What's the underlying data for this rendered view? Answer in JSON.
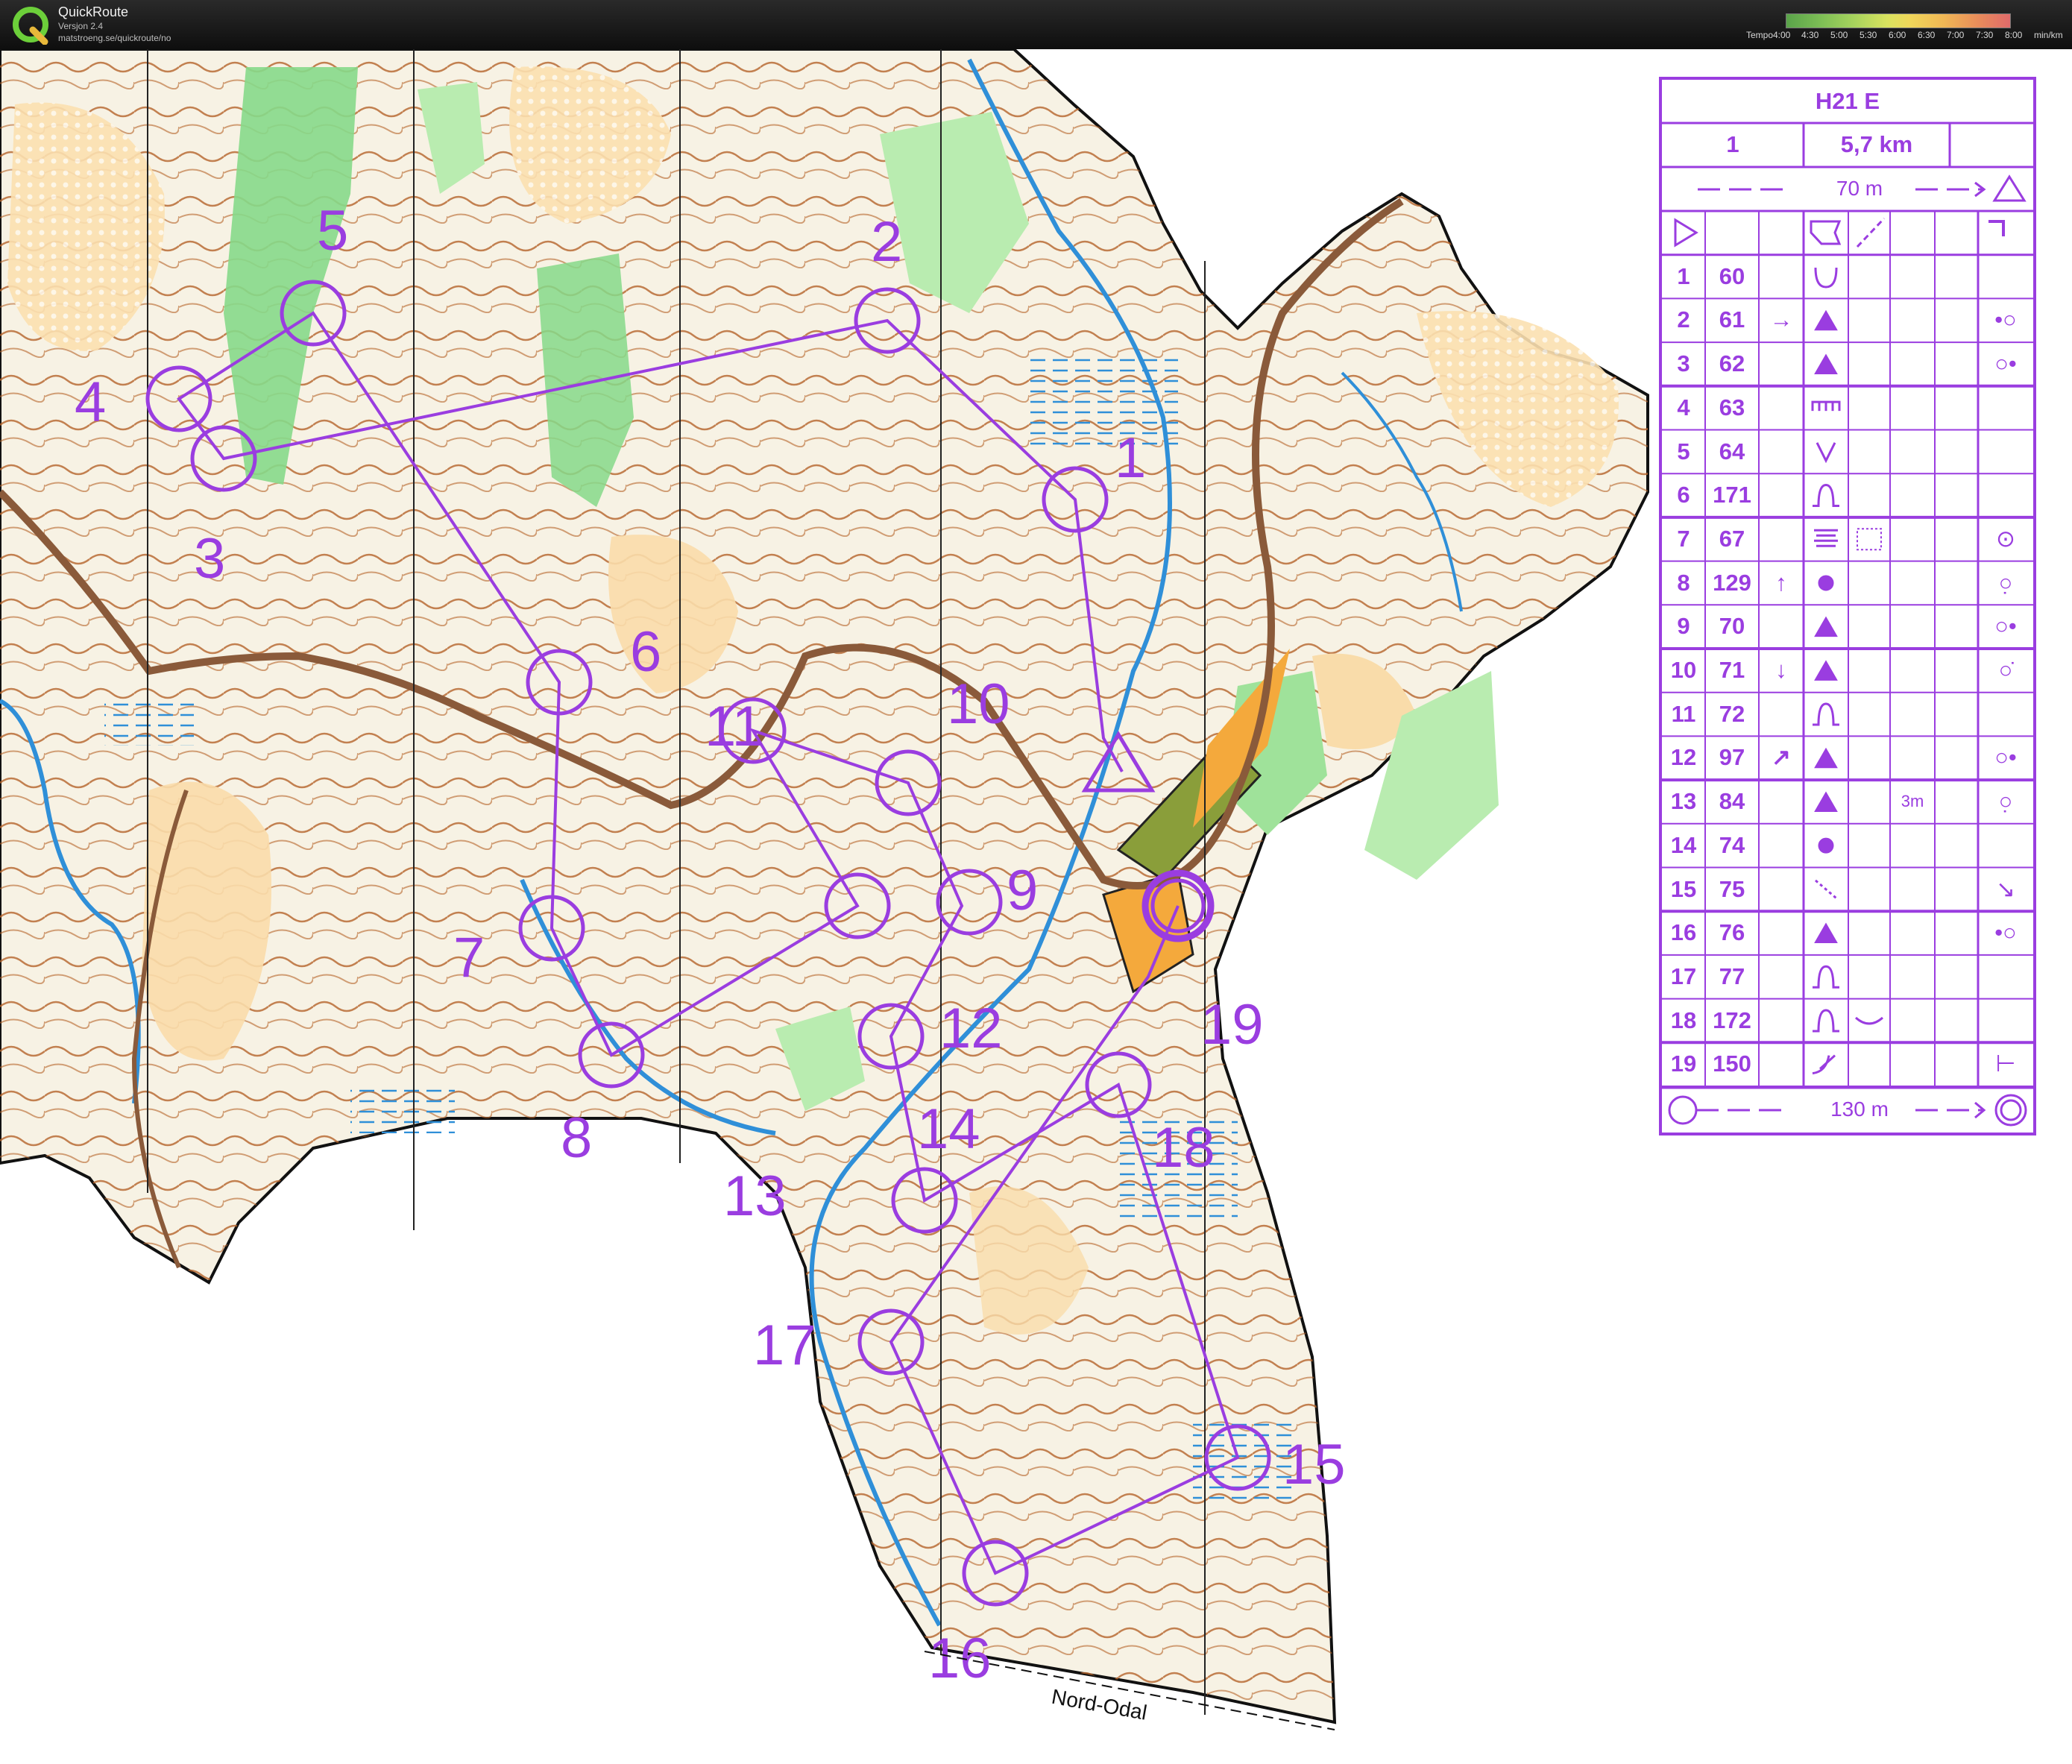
{
  "titlebar": {
    "app_name": "QuickRoute",
    "app_version": "Versjon 2.4",
    "app_url": "matstroeng.se/quickroute/no",
    "tempo_label": "Tempo",
    "tempo_ticks": [
      "4:00",
      "4:30",
      "5:00",
      "5:30",
      "6:00",
      "6:30",
      "7:00",
      "7:30",
      "8:00",
      "min/km"
    ]
  },
  "map": {
    "place_label": "Nord-Odal",
    "course_color": "#9a3de0",
    "controls": [
      {
        "n": "1"
      },
      {
        "n": "2"
      },
      {
        "n": "3"
      },
      {
        "n": "4"
      },
      {
        "n": "5"
      },
      {
        "n": "6"
      },
      {
        "n": "7"
      },
      {
        "n": "8"
      },
      {
        "n": "9"
      },
      {
        "n": "10"
      },
      {
        "n": "11"
      },
      {
        "n": "12"
      },
      {
        "n": "13"
      },
      {
        "n": "14"
      },
      {
        "n": "15"
      },
      {
        "n": "16"
      },
      {
        "n": "17"
      },
      {
        "n": "18"
      },
      {
        "n": "19"
      }
    ]
  },
  "description": {
    "class_name": "H21 E",
    "course_number": "1",
    "course_length": "5,7 km",
    "start_to_first": "70 m",
    "finish_distance": "130 m",
    "rows": [
      {
        "seq": "1",
        "code": "60",
        "dir": "",
        "feature": "reentrant",
        "extra": "",
        "pos": ""
      },
      {
        "seq": "2",
        "code": "61",
        "dir": "→",
        "feature": "boulder",
        "extra": "",
        "pos": "•○"
      },
      {
        "seq": "3",
        "code": "62",
        "dir": "",
        "feature": "boulder",
        "extra": "",
        "pos": "○•"
      },
      {
        "seq": "4",
        "code": "63",
        "dir": "",
        "feature": "cliff",
        "extra": "",
        "pos": ""
      },
      {
        "seq": "5",
        "code": "64",
        "dir": "",
        "feature": "gully",
        "extra": "",
        "pos": ""
      },
      {
        "seq": "6",
        "code": "171",
        "dir": "",
        "feature": "knoll",
        "extra": "",
        "pos": ""
      },
      {
        "seq": "7",
        "code": "67",
        "dir": "",
        "feature": "marsh",
        "extra": "thicket",
        "pos": "⊙"
      },
      {
        "seq": "8",
        "code": "129",
        "dir": "↑",
        "feature": "knoll-dot",
        "extra": "",
        "pos": "○̣"
      },
      {
        "seq": "9",
        "code": "70",
        "dir": "",
        "feature": "boulder",
        "extra": "",
        "pos": "○•"
      },
      {
        "seq": "10",
        "code": "71",
        "dir": "↓",
        "feature": "boulder",
        "extra": "",
        "pos": "○̇"
      },
      {
        "seq": "11",
        "code": "72",
        "dir": "",
        "feature": "knoll",
        "extra": "",
        "pos": ""
      },
      {
        "seq": "12",
        "code": "97",
        "dir": "↗",
        "feature": "boulder",
        "extra": "",
        "pos": "○•"
      },
      {
        "seq": "13",
        "code": "84",
        "dir": "",
        "feature": "boulder",
        "extra": "3m",
        "pos": "○̣"
      },
      {
        "seq": "14",
        "code": "74",
        "dir": "",
        "feature": "knoll-dot",
        "extra": "",
        "pos": ""
      },
      {
        "seq": "15",
        "code": "75",
        "dir": "",
        "feature": "path-end",
        "extra": "",
        "pos": "↘"
      },
      {
        "seq": "16",
        "code": "76",
        "dir": "",
        "feature": "boulder",
        "extra": "",
        "pos": "•○"
      },
      {
        "seq": "17",
        "code": "77",
        "dir": "",
        "feature": "knoll",
        "extra": "",
        "pos": ""
      },
      {
        "seq": "18",
        "code": "172",
        "dir": "",
        "feature": "knoll",
        "extra": "depression",
        "pos": ""
      },
      {
        "seq": "19",
        "code": "150",
        "dir": "",
        "feature": "crossing",
        "extra": "",
        "pos": "⊢"
      }
    ]
  }
}
